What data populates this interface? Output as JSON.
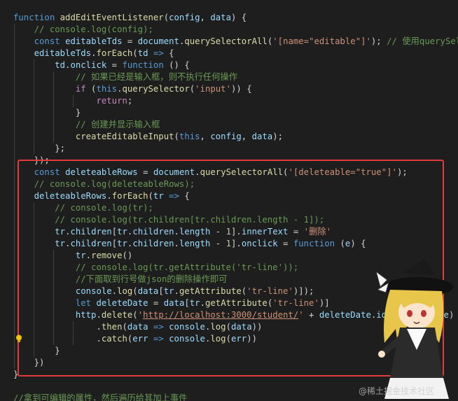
{
  "editor": {
    "language": "javascript",
    "theme": "dark",
    "lines": [
      "function addEditEventListener(config, data) {",
      "    // console.log(config);",
      "    const editableTds = document.querySelectorAll('[name=\"editable\"]'); // 使用querySelector",
      "    editableTds.forEach(td => {",
      "        td.onclick = function () {",
      "            // 如果已经是输入框，则不执行任何操作",
      "            if (this.querySelector('input')) {",
      "                return;",
      "            }",
      "            // 创建并显示输入框",
      "            createEditableInput(this, config, data);",
      "        };",
      "    });",
      "    const deleteableRows = document.querySelectorAll('[deleteable=\"true\"]');",
      "    // console.log(deleteableRows);",
      "    deleteableRows.forEach(tr => {",
      "        // console.log(tr);",
      "        // console.log(tr.children[tr.children.length - 1]);",
      "        tr.children[tr.children.length - 1].innerText = '删除'",
      "        tr.children[tr.children.length - 1].onclick = function (e) {",
      "            tr.remove()",
      "            // console.log(tr.getAttribute('tr-line'));",
      "            //下面取到行号做json的删除操作即可",
      "            console.log(data[tr.getAttribute('tr-line')]);",
      "            let deleteDate = data[tr.getAttribute('tr-line')]",
      "            http.delete('http://localhost:3000/student/' + deleteDate.id, deleteDate)",
      "                .then(data => console.log(data))",
      "                .catch(err => console.log(err))",
      "        }",
      "    })",
      "}",
      "",
      "//拿到可编辑的属性，然后遍历给其加上事件"
    ]
  },
  "watermark": {
    "text": "@稀土掘金技术社区"
  },
  "colors": {
    "background": "#1e1e1e",
    "highlight_box": "#e23b3b",
    "keyword": "#569cd6",
    "function": "#dcdcaa",
    "variable": "#9cdcfe",
    "string": "#ce9178",
    "comment": "#6a9955"
  },
  "icons": {
    "lightbulb": "lightbulb-icon",
    "mascot": "anime-mascot-sticker"
  }
}
